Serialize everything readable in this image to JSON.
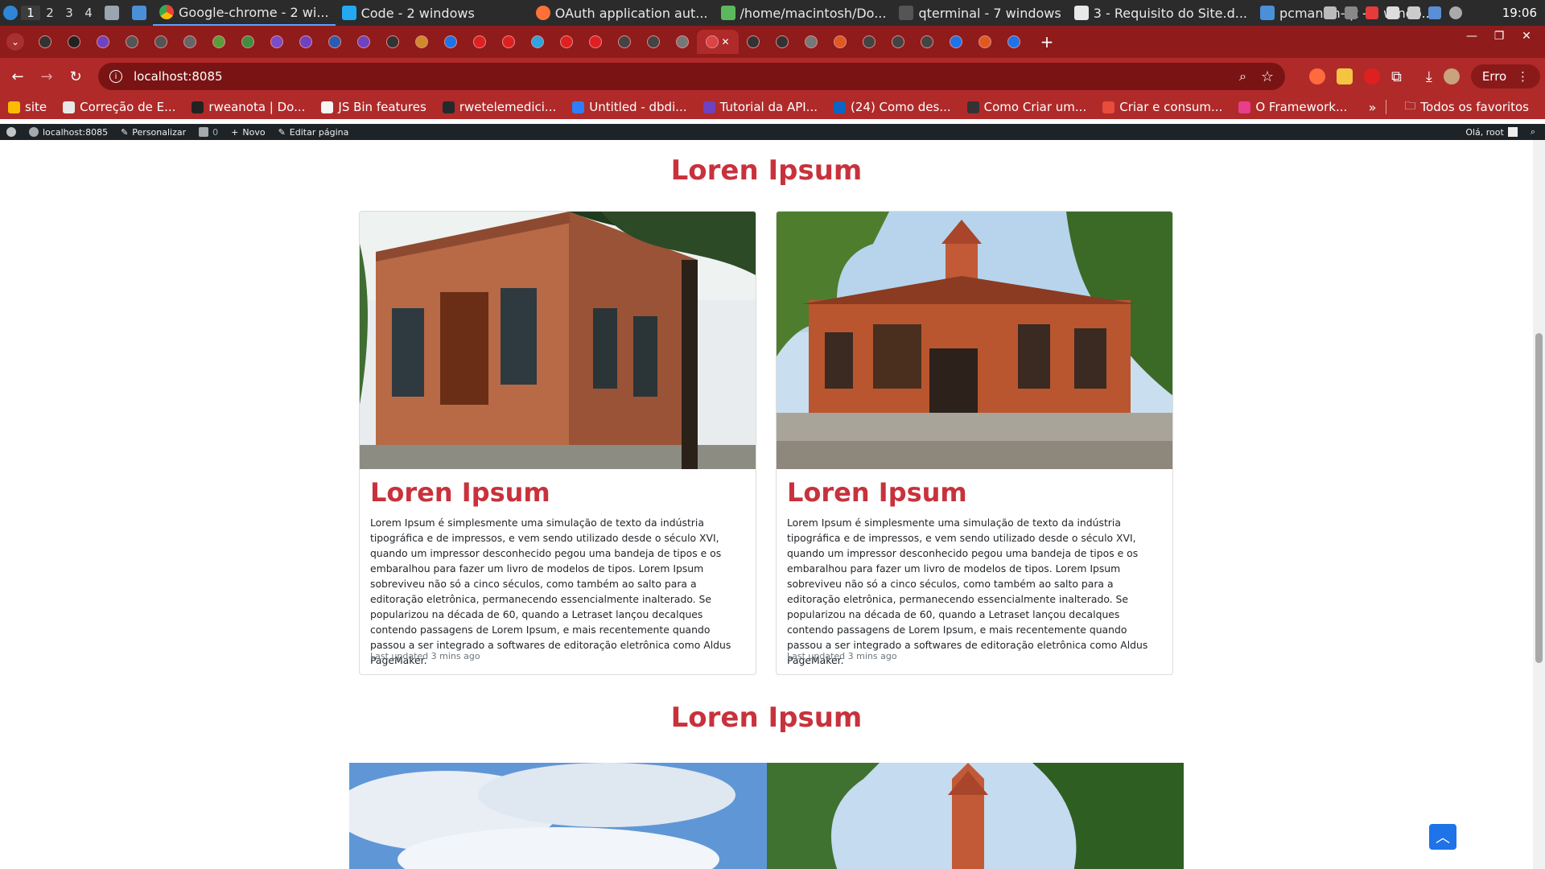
{
  "taskbar": {
    "workspaces": [
      "1",
      "2",
      "3",
      "4"
    ],
    "windows": [
      {
        "label": "Google-chrome - 2 wi...",
        "icon": "chrome-icon",
        "color": "#4285f4"
      },
      {
        "label": "Code - 2 windows",
        "icon": "vscode-icon",
        "color": "#23a9f2"
      },
      {
        "label": "OAuth application aut...",
        "icon": "firefox-icon",
        "color": "#ff7139"
      },
      {
        "label": "/home/macintosh/Do...",
        "icon": "image-viewer-icon",
        "color": "#5cb85c"
      },
      {
        "label": "qterminal - 7 windows",
        "icon": "terminal-icon",
        "color": "#555555"
      },
      {
        "label": "3 - Requisito do Site.d...",
        "icon": "document-icon",
        "color": "#e8e8e8"
      },
      {
        "label": "pcmanfm-qt - 5 windo...",
        "icon": "folder-icon",
        "color": "#4a90d9"
      }
    ],
    "clock": "19:06"
  },
  "browser": {
    "url": "localhost:8085",
    "profile_button": "Erro",
    "bookmarks": [
      {
        "label": "site",
        "color": "#fbbc04"
      },
      {
        "label": "Correção de E...",
        "color": "#e8e8e8"
      },
      {
        "label": "rweanota | Do...",
        "color": "#222222"
      },
      {
        "label": "JS Bin features",
        "color": "#f5f5f5"
      },
      {
        "label": "rwetelemedici...",
        "color": "#24292e"
      },
      {
        "label": "Untitled - dbdi...",
        "color": "#2d7ff9"
      },
      {
        "label": "Tutorial da API...",
        "color": "#6f42c1"
      },
      {
        "label": "(24) Como des...",
        "color": "#0a66c2"
      },
      {
        "label": "Como Criar um...",
        "color": "#333333"
      },
      {
        "label": "Criar e consum...",
        "color": "#e74c3c"
      },
      {
        "label": "O Framework...",
        "color": "#e83e8c"
      }
    ],
    "all_bookmarks": "Todos os favoritos"
  },
  "wpadmin": {
    "site": "localhost:8085",
    "customize": "Personalizar",
    "comments": "0",
    "new": "Novo",
    "edit": "Editar página",
    "greeting": "Olá, root"
  },
  "page": {
    "section1_title": "Loren Ipsum",
    "section2_title": "Loren Ipsum",
    "cards": [
      {
        "title": "Loren Ipsum",
        "text": "Lorem Ipsum é simplesmente uma simulação de texto da indústria tipográfica e de impressos, e vem sendo utilizado desde o século XVI, quando um impressor desconhecido pegou uma bandeja de tipos e os embaralhou para fazer um livro de modelos de tipos. Lorem Ipsum sobreviveu não só a cinco séculos, como também ao salto para a editoração eletrônica, permanecendo essencialmente inalterado. Se popularizou na década de 60, quando a Letraset lançou decalques contendo passagens de Lorem Ipsum, e mais recentemente quando passou a ser integrado a softwares de editoração eletrônica como Aldus PageMaker.",
        "meta": "Last updated 3 mins ago"
      },
      {
        "title": "Loren Ipsum",
        "text": "Lorem Ipsum é simplesmente uma simulação de texto da indústria tipográfica e de impressos, e vem sendo utilizado desde o século XVI, quando um impressor desconhecido pegou uma bandeja de tipos e os embaralhou para fazer um livro de modelos de tipos. Lorem Ipsum sobreviveu não só a cinco séculos, como também ao salto para a editoração eletrônica, permanecendo essencialmente inalterado. Se popularizou na década de 60, quando a Letraset lançou decalques contendo passagens de Lorem Ipsum, e mais recentemente quando passou a ser integrado a softwares de editoração eletrônica como Aldus PageMaker.",
        "meta": "Last updated 3 mins ago"
      }
    ]
  },
  "colors": {
    "accent": "#c8323c",
    "browser_theme": "#b02a2a",
    "wp_bar": "#1d2327",
    "to_top_button": "#1e73e8"
  }
}
